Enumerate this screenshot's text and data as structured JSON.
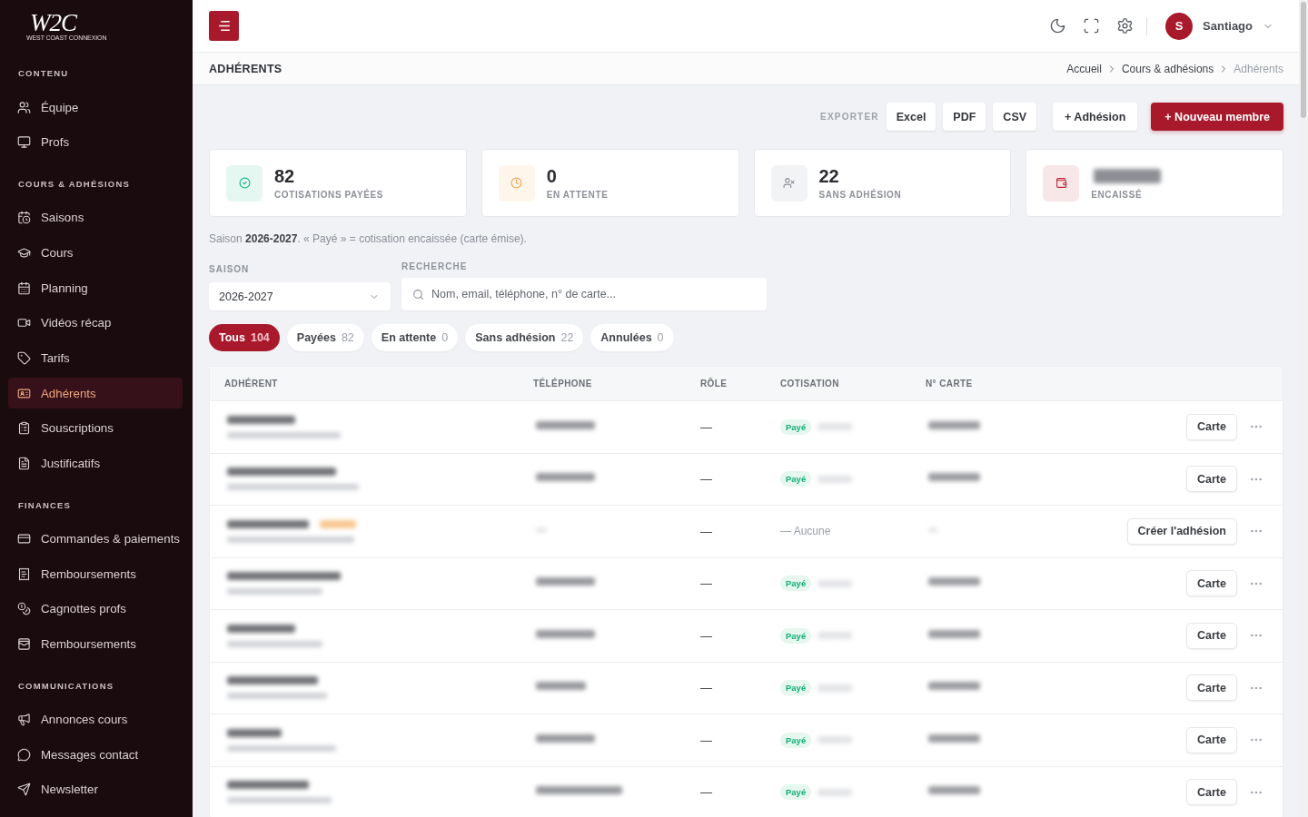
{
  "sidebar": {
    "logo": {
      "mark": "W2C",
      "tagline": "WEST COAST CONNEXION"
    },
    "sections": [
      {
        "title": "CONTENU",
        "items": [
          {
            "label": "Équipe",
            "selected": false
          },
          {
            "label": "Profs",
            "selected": false
          }
        ]
      },
      {
        "title": "COURS & ADHÉSIONS",
        "items": [
          {
            "label": "Saisons",
            "selected": false
          },
          {
            "label": "Cours",
            "selected": false
          },
          {
            "label": "Planning",
            "selected": false
          },
          {
            "label": "Vidéos récap",
            "selected": false
          },
          {
            "label": "Tarifs",
            "selected": false
          },
          {
            "label": "Adhérents",
            "selected": true
          },
          {
            "label": "Souscriptions",
            "selected": false
          },
          {
            "label": "Justificatifs",
            "selected": false
          }
        ]
      },
      {
        "title": "FINANCES",
        "items": [
          {
            "label": "Commandes & paiements",
            "selected": false
          },
          {
            "label": "Remboursements",
            "selected": false
          },
          {
            "label": "Cagnottes profs",
            "selected": false
          },
          {
            "label": "Remboursements",
            "selected": false
          }
        ]
      },
      {
        "title": "COMMUNICATIONS",
        "items": [
          {
            "label": "Annonces cours",
            "selected": false
          },
          {
            "label": "Messages contact",
            "selected": false
          },
          {
            "label": "Newsletter",
            "selected": false
          }
        ]
      }
    ]
  },
  "topbar": {
    "user": {
      "initial": "S",
      "name": "Santiago"
    }
  },
  "page_header": {
    "title": "ADHÉRENTS",
    "breadcrumb": [
      {
        "label": "Accueil",
        "current": false
      },
      {
        "label": "Cours & adhésions",
        "current": false
      },
      {
        "label": "Adhérents",
        "current": true
      }
    ]
  },
  "toolbar": {
    "export_label": "EXPORTER",
    "export_buttons": [
      "Excel",
      "PDF",
      "CSV"
    ],
    "actions": [
      {
        "label": "+ Adhésion",
        "kind": "secondary"
      },
      {
        "label": "+ Nouveau membre",
        "kind": "primary"
      }
    ]
  },
  "stats": [
    {
      "value": "82",
      "label": "COTISATIONS PAYÉES",
      "color": "#10b981",
      "blurred": false
    },
    {
      "value": "0",
      "label": "EN ATTENTE",
      "color": "#f2a24b",
      "blurred": false
    },
    {
      "value": "22",
      "label": "SANS ADHÉSION",
      "color": "#8b9099",
      "blurred": false
    },
    {
      "label": "ENCAISSÉ",
      "color": "#c0263a",
      "blurred": true
    }
  ],
  "note": "Saison **2026-2027**. « Payé » = cotisation encaissée (carte émise).",
  "filters": {
    "season": {
      "label": "SAISON",
      "value": "2026-2027"
    },
    "search": {
      "label": "RECHERCHE",
      "placeholder": "Nom, email, téléphone, n° de carte..."
    }
  },
  "tabs": [
    {
      "label": "Tous",
      "count": "104",
      "selected": true
    },
    {
      "label": "Payées",
      "count": "82",
      "selected": false
    },
    {
      "label": "En attente",
      "count": "0",
      "selected": false
    },
    {
      "label": "Sans adhésion",
      "count": "22",
      "selected": false
    },
    {
      "label": "Annulées",
      "count": "0",
      "selected": false
    }
  ],
  "table": {
    "columns": [
      "ADHÉRENT",
      "TÉLÉPHONE",
      "RÔLE",
      "COTISATION",
      "N° CARTE"
    ],
    "rows": [
      {
        "role": "—",
        "status": {
          "kind": "paid",
          "label": "Payé"
        },
        "action": "Carte",
        "tagged": false,
        "phone_missing": false
      },
      {
        "role": "—",
        "status": {
          "kind": "paid",
          "label": "Payé"
        },
        "action": "Carte",
        "tagged": false,
        "phone_missing": false
      },
      {
        "role": "—",
        "status": {
          "kind": "none",
          "label": "— Aucune"
        },
        "action": "Créer l'adhésion",
        "tagged": true,
        "phone_missing": true
      },
      {
        "role": "—",
        "status": {
          "kind": "paid",
          "label": "Payé"
        },
        "action": "Carte",
        "tagged": false,
        "phone_missing": false
      },
      {
        "role": "—",
        "status": {
          "kind": "paid",
          "label": "Payé"
        },
        "action": "Carte",
        "tagged": false,
        "phone_missing": false
      },
      {
        "role": "—",
        "status": {
          "kind": "paid",
          "label": "Payé"
        },
        "action": "Carte",
        "tagged": false,
        "phone_missing": false
      },
      {
        "role": "—",
        "status": {
          "kind": "paid",
          "label": "Payé"
        },
        "action": "Carte",
        "tagged": false,
        "phone_missing": false
      },
      {
        "role": "—",
        "status": {
          "kind": "paid",
          "label": "Payé"
        },
        "action": "Carte",
        "tagged": false,
        "phone_missing": false
      }
    ]
  }
}
